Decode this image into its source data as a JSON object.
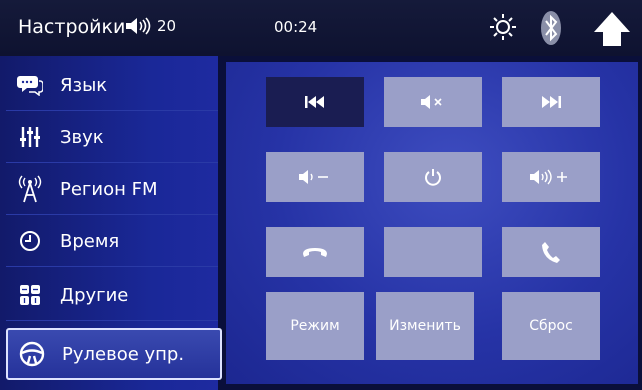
{
  "header": {
    "title": "Настройки",
    "volume": "20",
    "time": "00:24",
    "icons": [
      "speaker-icon",
      "brightness-icon",
      "bluetooth-icon",
      "home-icon"
    ]
  },
  "sidebar": {
    "items": [
      {
        "label": "Язык",
        "icon": "speech-bubble-icon"
      },
      {
        "label": "Звук",
        "icon": "equalizer-icon"
      },
      {
        "label": "Регион FM",
        "icon": "antenna-icon"
      },
      {
        "label": "Время",
        "icon": "clock-icon"
      },
      {
        "label": "Другие",
        "icon": "grid-icon"
      },
      {
        "label": "Рулевое упр.",
        "icon": "steering-wheel-icon",
        "active": true
      }
    ]
  },
  "panel": {
    "buttons": {
      "mode": "Режим",
      "change": "Изменить",
      "reset": "Сброс"
    },
    "icons": [
      "prev-track-icon",
      "mute-icon",
      "next-track-icon",
      "volume-down-icon",
      "power-icon",
      "volume-up-icon",
      "hang-up-icon",
      "call-icon"
    ]
  },
  "colors": {
    "button_gray": "#9a9fc8",
    "button_selected": "#1a1d52",
    "panel_blue": "#2633a6"
  }
}
